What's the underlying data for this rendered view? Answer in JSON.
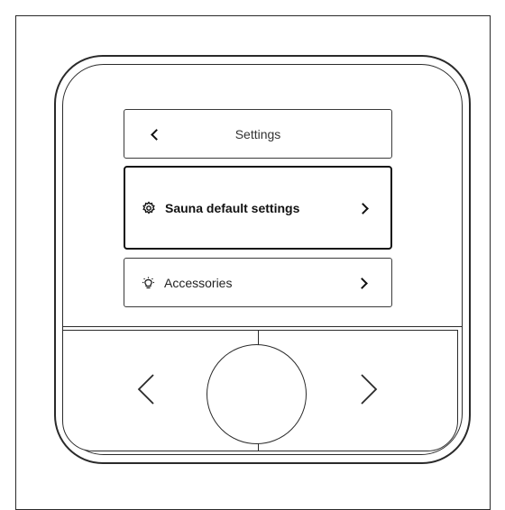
{
  "menu": {
    "header": {
      "title": "Settings",
      "back_icon": "chevron-left-icon"
    },
    "items": [
      {
        "label": "Sauna default settings",
        "icon": "gear-icon",
        "selected": true,
        "arrow_icon": "chevron-right-icon"
      },
      {
        "label": "Accessories",
        "icon": "lightbulb-icon",
        "selected": false,
        "arrow_icon": "chevron-right-icon"
      }
    ]
  },
  "controls": {
    "left_button_icon": "chevron-left-icon",
    "center_button_icon": "circle-button",
    "right_button_icon": "chevron-right-icon"
  },
  "colors": {
    "outline": "#2a2a2a",
    "background": "#ffffff"
  }
}
